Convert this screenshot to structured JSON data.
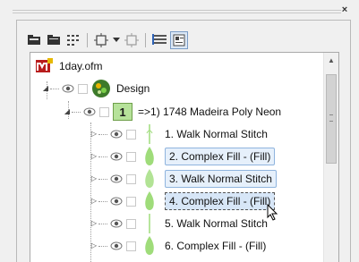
{
  "window": {
    "close_glyph": "×"
  },
  "toolbar": {
    "icons": [
      "folder-open-icon",
      "folder-closed-icon",
      "grid-icon",
      "frame-icon",
      "dropdown-arrow-icon",
      "frame-disabled-icon",
      "list-icon",
      "properties-icon"
    ]
  },
  "tree": {
    "root": {
      "label": "1day.ofm",
      "icon": "ofm-logo-icon"
    },
    "design": {
      "label": "Design",
      "icon": "design-globe-icon"
    },
    "color_group": {
      "number": "1",
      "label": "=>1) 1748 Madeira Poly Neon",
      "color": "#b6e29a"
    },
    "items": [
      {
        "label": "1. Walk Normal Stitch",
        "state": "normal"
      },
      {
        "label": "2. Complex Fill - (Fill)",
        "state": "selected"
      },
      {
        "label": "3. Walk Normal Stitch",
        "state": "selected"
      },
      {
        "label": "4. Complex Fill - (Fill)",
        "state": "focused"
      },
      {
        "label": "5. Walk Normal Stitch",
        "state": "normal"
      },
      {
        "label": "6. Complex Fill - (Fill)",
        "state": "normal"
      }
    ]
  },
  "colors": {
    "accent": "#8fb4de",
    "thread": "#9fdc7a",
    "background": "#f0f0f0"
  }
}
